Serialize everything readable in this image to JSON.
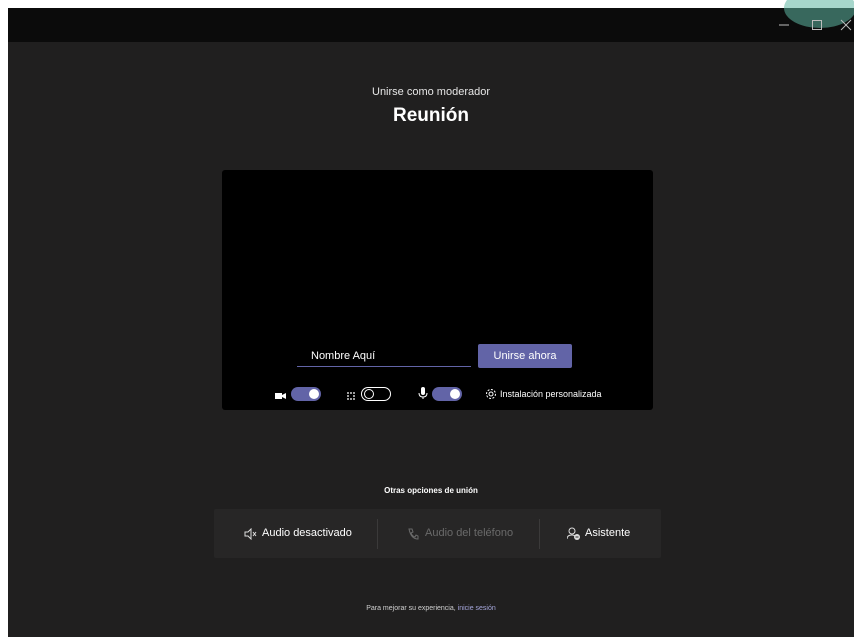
{
  "window": {
    "controls": [
      "minimize-icon",
      "maximize-icon",
      "close-icon"
    ]
  },
  "meeting": {
    "subtitle": "Unirse como moderador",
    "title": "Reunión"
  },
  "prejoin": {
    "name_value": "Nombre Aquí",
    "join_label": "Unirse ahora",
    "camera_on": true,
    "background_blur_on": false,
    "mic_on": true,
    "settings_label": "Instalación personalizada",
    "accent_color": "#6264a7"
  },
  "other_options": {
    "title": "Otras opciones de unión",
    "items": [
      {
        "label": "Audio desactivado",
        "icon": "speaker-off-icon",
        "enabled": true
      },
      {
        "label": "Audio del teléfono",
        "icon": "phone-icon",
        "enabled": false
      },
      {
        "label": "Asistente",
        "icon": "person-add-icon",
        "enabled": true
      }
    ]
  },
  "footer": {
    "text": "Para mejorar su experiencia, ",
    "link": "inicie sesión"
  }
}
